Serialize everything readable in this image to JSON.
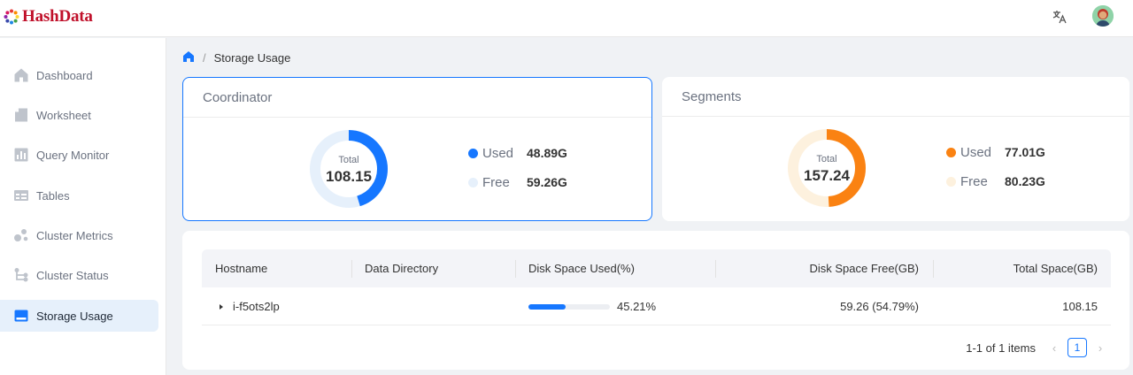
{
  "app": {
    "name": "HashData",
    "logo_icon": "hashdata-logo-icon"
  },
  "header": {
    "translate_icon": "translate-icon",
    "avatar_icon": "user-avatar"
  },
  "sidebar": {
    "items": [
      {
        "label": "Dashboard",
        "icon": "home-icon",
        "active": false
      },
      {
        "label": "Worksheet",
        "icon": "document-icon",
        "active": false
      },
      {
        "label": "Query Monitor",
        "icon": "bar-chart-icon",
        "active": false
      },
      {
        "label": "Tables",
        "icon": "table-icon",
        "active": false
      },
      {
        "label": "Cluster Metrics",
        "icon": "bubbles-icon",
        "active": false
      },
      {
        "label": "Cluster Status",
        "icon": "nodes-icon",
        "active": false
      },
      {
        "label": "Storage Usage",
        "icon": "storage-icon",
        "active": true
      }
    ]
  },
  "breadcrumb": {
    "home_icon": "home-icon",
    "separator": "/",
    "current": "Storage Usage"
  },
  "coordinator": {
    "title": "Coordinator",
    "total_label": "Total",
    "total_value": "108.15",
    "used_fraction": 0.4521,
    "used_label": "Used",
    "used_value": "48.89G",
    "free_label": "Free",
    "free_value": "59.26G",
    "used_color": "#1677ff",
    "free_color": "#e6f0fb"
  },
  "segments": {
    "title": "Segments",
    "total_label": "Total",
    "total_value": "157.24",
    "used_fraction": 0.4898,
    "used_label": "Used",
    "used_value": "77.01G",
    "free_label": "Free",
    "free_value": "80.23G",
    "used_color": "#fa8212",
    "free_color": "#fdf1de"
  },
  "table": {
    "columns": [
      "Hostname",
      "Data Directory",
      "Disk Space Used(%)",
      "Disk Space Free(GB)",
      "Total Space(GB)"
    ],
    "rows": [
      {
        "hostname": "i-f5ots2lp",
        "data_directory": "",
        "used_pct_text": "45.21%",
        "used_fraction": 0.4521,
        "free": "59.26 (54.79%)",
        "total": "108.15"
      }
    ]
  },
  "pagination": {
    "summary": "1-1 of 1 items",
    "current_page": "1",
    "prev": "‹",
    "next": "›"
  }
}
